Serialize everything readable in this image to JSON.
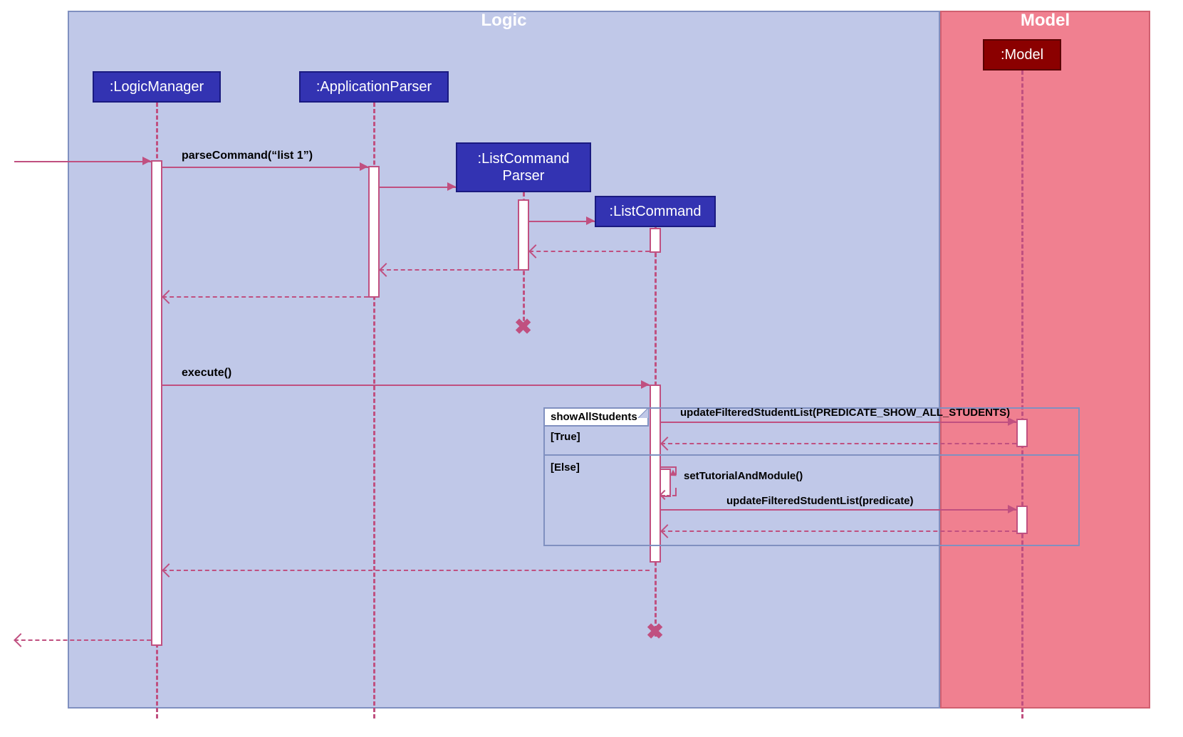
{
  "frames": {
    "logic": "Logic",
    "model": "Model"
  },
  "participants": {
    "logicManager": ":LogicManager",
    "applicationParser": ":ApplicationParser",
    "listCommandParser": ":ListCommand\nParser",
    "listCommandParser_l1": ":ListCommand",
    "listCommandParser_l2": "Parser",
    "listCommand": ":ListCommand",
    "model": ":Model"
  },
  "messages": {
    "parseCommand": "parseCommand(“list 1”)",
    "execute": "execute()",
    "updateAll": "updateFilteredStudentList(PREDICATE_SHOW_ALL_STUDENTS)",
    "setTutorial": "setTutorialAndModule()",
    "updatePred": "updateFilteredStudentList(predicate)"
  },
  "fragment": {
    "name": "showAllStudents",
    "guardTrue": "[True]",
    "guardElse": "[Else]"
  }
}
